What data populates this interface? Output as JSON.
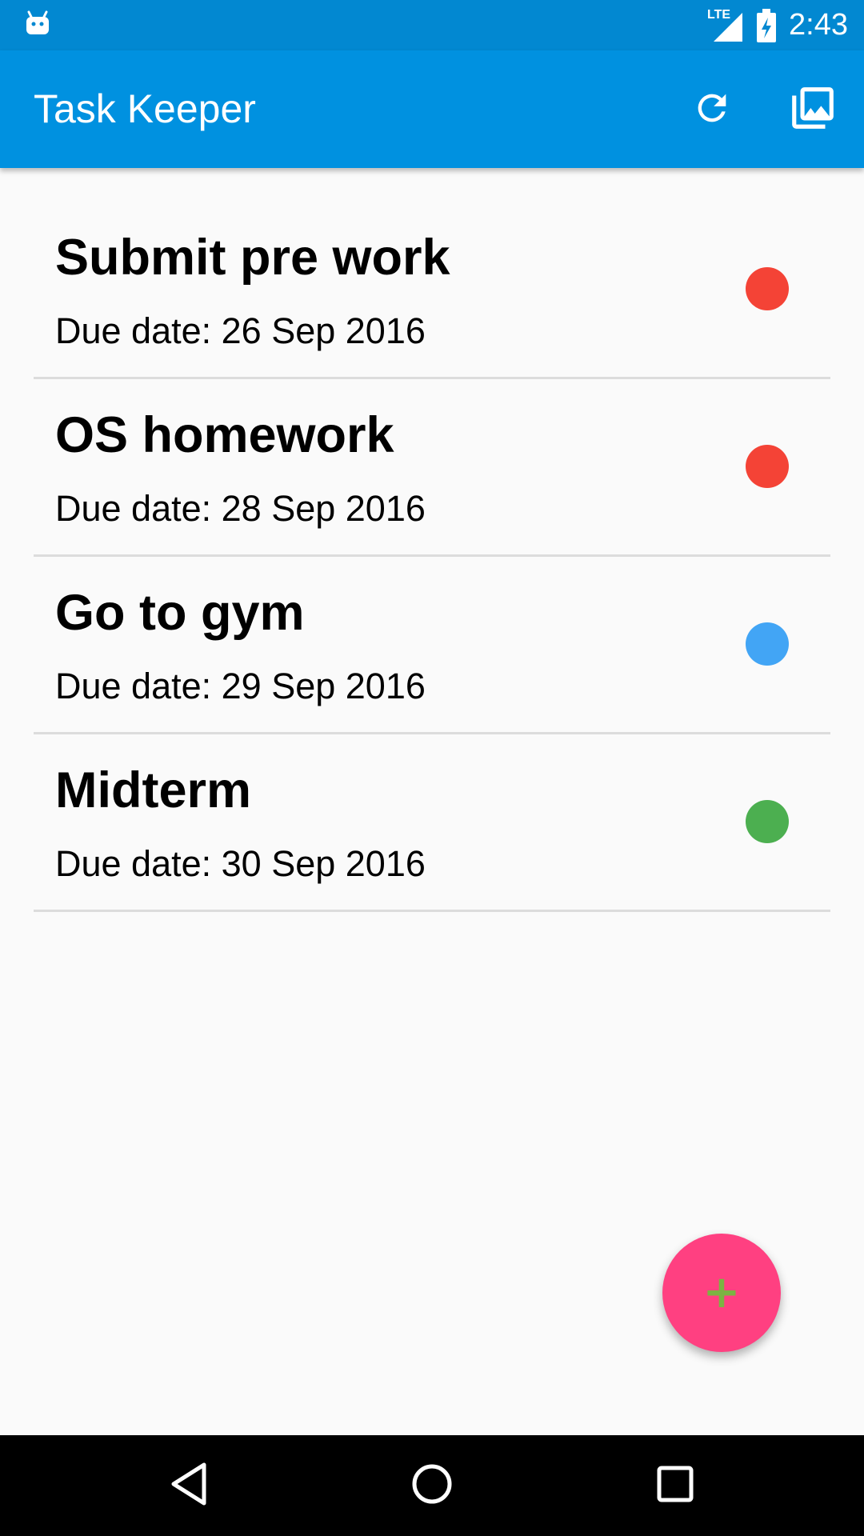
{
  "status_bar": {
    "network_label": "LTE",
    "time": "2:43"
  },
  "app_bar": {
    "title": "Task Keeper",
    "icons": [
      "refresh-icon",
      "gallery-icon"
    ],
    "color": "#0091e0"
  },
  "tasks": [
    {
      "title": "Submit pre work",
      "due": "Due date: 26 Sep 2016",
      "priority_color": "#f44336"
    },
    {
      "title": "OS homework",
      "due": "Due date: 28 Sep 2016",
      "priority_color": "#f44336"
    },
    {
      "title": "Go to gym",
      "due": "Due date: 29 Sep 2016",
      "priority_color": "#42a5f5"
    },
    {
      "title": "Midterm",
      "due": "Due date: 30 Sep 2016",
      "priority_color": "#4caf50"
    }
  ],
  "fab": {
    "label": "+",
    "color": "#ff4081"
  },
  "nav_bar": {
    "icons": [
      "back-icon",
      "home-icon",
      "recents-icon"
    ]
  }
}
